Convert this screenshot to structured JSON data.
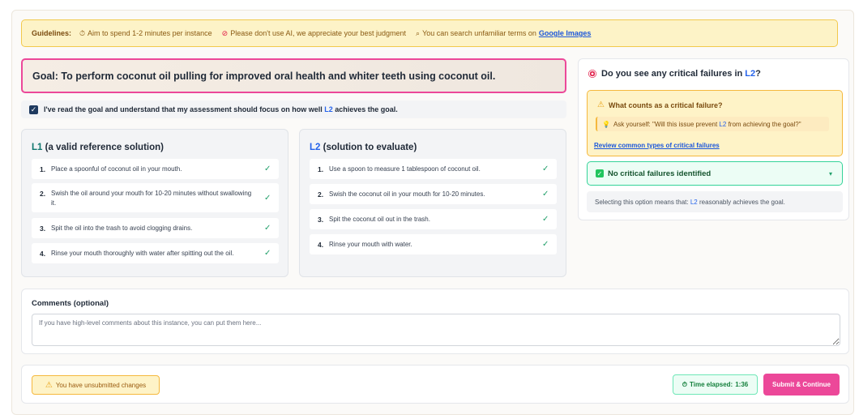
{
  "guidelines": {
    "title": "Guidelines:",
    "items": [
      {
        "icon": "clock-icon",
        "text": "Aim to spend 1-2 minutes per instance"
      },
      {
        "icon": "no-entry-icon",
        "text": "Please don't use AI, we appreciate your best judgment"
      },
      {
        "icon": "magnifier-icon",
        "text": "You can search unfamiliar terms on"
      }
    ],
    "link": "Google Images"
  },
  "goal": {
    "text": "Goal: To perform coconut oil pulling for improved oral health and whiter teeth using coconut oil."
  },
  "acknowledge": {
    "prefix": "I've read the goal and understand that my assessment should focus on how well",
    "ref": "L2",
    "suffix": "achieves the goal.",
    "checked": true
  },
  "l1": {
    "tag": "L1",
    "title_rest": "(a valid reference solution)",
    "steps": [
      {
        "num": "1.",
        "text": "Place a spoonful of coconut oil in your mouth."
      },
      {
        "num": "2.",
        "text": "Swish the oil around your mouth for 10-20 minutes without swallowing it."
      },
      {
        "num": "3.",
        "text": "Spit the oil into the trash to avoid clogging drains."
      },
      {
        "num": "4.",
        "text": "Rinse your mouth thoroughly with water after spitting out the oil."
      }
    ]
  },
  "l2": {
    "tag": "L2",
    "title_rest": "(solution to evaluate)",
    "steps": [
      {
        "num": "1.",
        "text": "Use a spoon to measure 1 tablespoon of coconut oil."
      },
      {
        "num": "2.",
        "text": "Swish the coconut oil in your mouth for 10-20 minutes."
      },
      {
        "num": "3.",
        "text": "Spit the coconut oil out in the trash."
      },
      {
        "num": "4.",
        "text": "Rinse your mouth with water."
      }
    ]
  },
  "assessment": {
    "question_prefix": "Do you see any critical failures in",
    "question_ref": "L2",
    "question_suffix": "?",
    "crit_title": "What counts as a critical failure?",
    "ask_prefix": "Ask yourself: \"Will this issue prevent",
    "ask_ref": "L2",
    "ask_suffix": "from achieving the goal?\"",
    "review_link": "Review common types of critical failures",
    "selected": "No critical failures identified",
    "note_prefix": "Selecting this option means that:",
    "note_ref": "L2",
    "note_suffix": "reasonably achieves the goal."
  },
  "comments": {
    "label": "Comments (optional)",
    "placeholder": "If you have high-level comments about this instance, you can put them here...",
    "value": ""
  },
  "footer": {
    "unsubmitted": "You have unsubmitted changes",
    "timer_label": "Time elapsed:",
    "timer_value": "1:36",
    "submit": "Submit & Continue"
  },
  "colors": {
    "accent": "#ec4899",
    "warning_bg": "#fef3c7",
    "success": "#22c55e",
    "link": "#1a56db"
  }
}
